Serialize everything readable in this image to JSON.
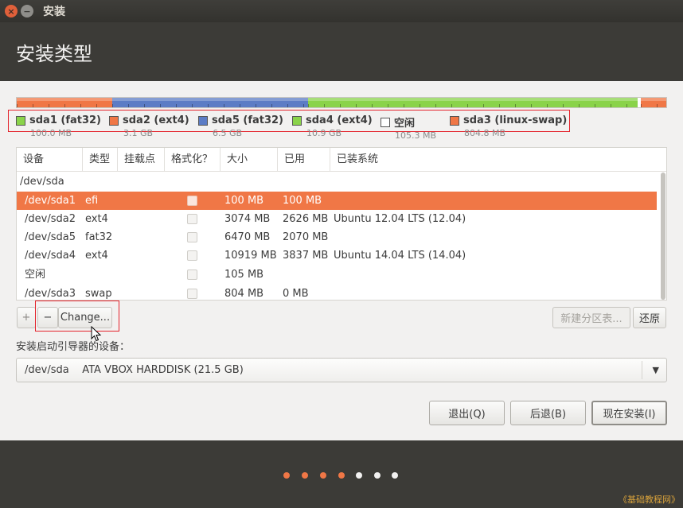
{
  "window": {
    "title": "安装"
  },
  "header": {
    "title": "安装类型"
  },
  "partition_bar": {
    "segments": [
      {
        "color": "#f07746"
      },
      {
        "color": "#5c7cc5"
      },
      {
        "color": "#8ad34a"
      },
      {
        "color": "#ffffff"
      },
      {
        "color": "#f07746"
      }
    ]
  },
  "legend": [
    {
      "name": "sda1 (fat32)",
      "size": "100.0 MB",
      "color": "#8ad34a"
    },
    {
      "name": "sda2 (ext4)",
      "size": "3.1 GB",
      "color": "#f07746"
    },
    {
      "name": "sda5 (fat32)",
      "size": "6.5 GB",
      "color": "#5c7cc5"
    },
    {
      "name": "sda4 (ext4)",
      "size": "10.9 GB",
      "color": "#8ad34a"
    },
    {
      "name": "空闲",
      "size": "105.3 MB",
      "color": "#ffffff"
    },
    {
      "name": "sda3 (linux-swap)",
      "size": "804.8 MB",
      "color": "#f07746"
    }
  ],
  "table": {
    "columns": [
      "设备",
      "类型",
      "挂载点",
      "格式化？",
      "大小",
      "已用",
      "已装系统"
    ],
    "group": "/dev/sda",
    "rows": [
      {
        "device": "/dev/sda1",
        "type": "efi",
        "mount": "",
        "size": "100 MB",
        "used": "100 MB",
        "system": ""
      },
      {
        "device": "/dev/sda2",
        "type": "ext4",
        "mount": "",
        "size": "3074 MB",
        "used": "2626 MB",
        "system": "Ubuntu 12.04 LTS (12.04)"
      },
      {
        "device": "/dev/sda5",
        "type": "fat32",
        "mount": "",
        "size": "6470 MB",
        "used": "2070 MB",
        "system": ""
      },
      {
        "device": "/dev/sda4",
        "type": "ext4",
        "mount": "",
        "size": "10919 MB",
        "used": "3837 MB",
        "system": "Ubuntu 14.04 LTS (14.04)"
      },
      {
        "device": "空闲",
        "type": "",
        "mount": "",
        "size": "105 MB",
        "used": "",
        "system": ""
      },
      {
        "device": "/dev/sda3",
        "type": "swap",
        "mount": "",
        "size": "804 MB",
        "used": "0 MB",
        "system": ""
      }
    ]
  },
  "toolbar": {
    "add": "+",
    "remove": "−",
    "change": "Change...",
    "new_table": "新建分区表...",
    "revert": "还原"
  },
  "bootloader": {
    "label": "安装启动引导器的设备：",
    "value": "/dev/sda    ATA VBOX HARDDISK (21.5 GB)"
  },
  "buttons": {
    "quit": "退出(Q)",
    "back": "后退(B)",
    "install_now": "现在安装(I)"
  },
  "progress_dots": [
    {
      "color": "#f07746"
    },
    {
      "color": "#f07746"
    },
    {
      "color": "#f07746"
    },
    {
      "color": "#f07746"
    },
    {
      "color": "#f2f1f0"
    },
    {
      "color": "#f2f1f0"
    },
    {
      "color": "#f2f1f0"
    }
  ],
  "watermark": "《基础教程网》"
}
